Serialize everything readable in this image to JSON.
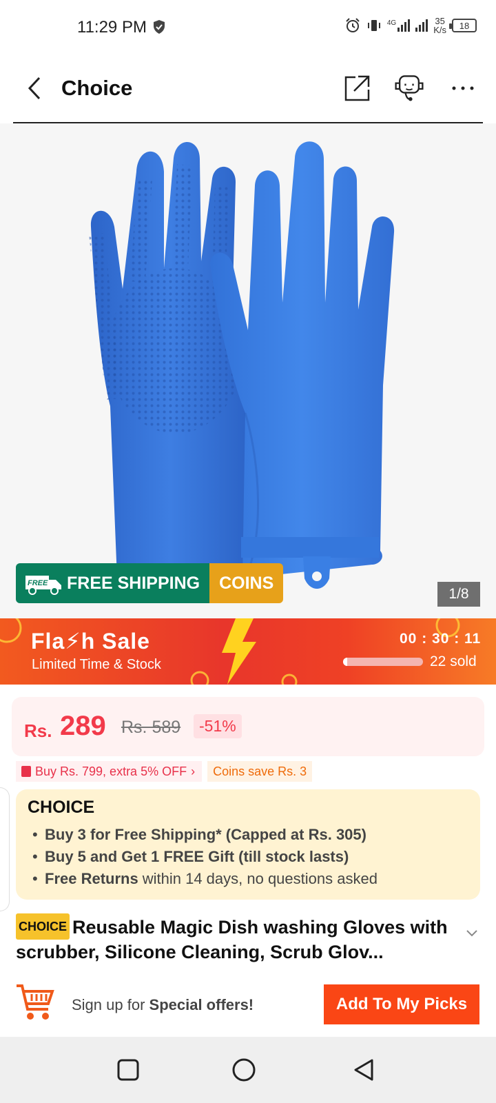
{
  "status_bar": {
    "time": "11:29 PM",
    "network": "4G",
    "speed_value": "35",
    "speed_unit": "K/s",
    "battery": "18"
  },
  "header": {
    "title": "Choice"
  },
  "gallery": {
    "counter": "1/8",
    "badge_free_icon_text": "FREE",
    "badge_shipping": "FREE SHIPPING",
    "badge_coins": "COINS"
  },
  "flash_sale": {
    "title": "Fla⚡h Sale",
    "subtitle": "Limited Time & Stock",
    "countdown": "00 : 30 : 11",
    "sold": "22 sold",
    "progress_fraction": 0.05
  },
  "price": {
    "currency": "Rs.",
    "current": "289",
    "original": "Rs. 589",
    "discount": "-51%"
  },
  "promos": {
    "offer": "Buy Rs. 799, extra 5% OFF",
    "coins": "Coins save Rs. 3"
  },
  "choice": {
    "logo": "CHOICE",
    "items": [
      {
        "bold": "Buy 3 for  Free Shipping* (Capped at Rs. 305)",
        "rest": ""
      },
      {
        "bold": "Buy 5 and Get 1 FREE Gift (till stock lasts)",
        "rest": ""
      },
      {
        "bold": "Free Returns",
        "rest": "within 14 days, no questions asked"
      }
    ]
  },
  "product": {
    "badge": "CHOICE",
    "title": "Reusable Magic Dish washing Gloves with scrubber, Silicone Cleaning, Scrub Glov..."
  },
  "bottom_bar": {
    "signup_prefix": "Sign up for",
    "signup_bold": "Special offers!",
    "add_button": "Add To My Picks"
  },
  "colors": {
    "accent": "#fa4615",
    "price_red": "#f23a4a",
    "shipping_green": "#0a7f5d",
    "coins_gold": "#e7a11a",
    "choice_bg": "#fff3d2",
    "glove_blue": "#3a78dc"
  }
}
